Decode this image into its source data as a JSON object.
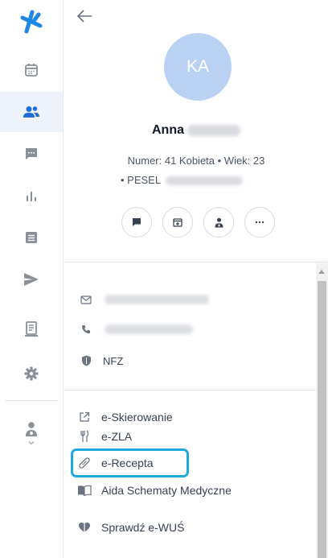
{
  "sidebar": {
    "items": [
      {
        "icon": "logo-icon"
      },
      {
        "icon": "calendar-icon"
      },
      {
        "icon": "patients-icon",
        "active": true
      },
      {
        "icon": "chat-icon"
      },
      {
        "icon": "stats-icon"
      },
      {
        "icon": "list-icon"
      },
      {
        "icon": "send-icon"
      },
      {
        "icon": "document-icon"
      },
      {
        "icon": "settings-icon"
      },
      {
        "icon": "doctor-icon"
      }
    ],
    "colors": {
      "logo": "#1e88e5",
      "active_bg": "#eef3fb",
      "active_icon": "#1e6fd9",
      "icon": "#8a9098"
    }
  },
  "patient": {
    "initials": "KA",
    "first_name": "Anna",
    "meta_line1": "Numer: 41   Kobieta • Wiek: 23",
    "meta_line2": "• PESEL"
  },
  "contact": {
    "insurer": "NFZ"
  },
  "links": {
    "e_skierowanie": "e-Skierowanie",
    "e_zla": "e-ZLA",
    "e_recepta": "e-Recepta",
    "aida": "Aida Schematy Medyczne",
    "ewus": "Sprawdź e-WUŚ"
  },
  "colors": {
    "highlight": "#1fa9e1",
    "avatar": "#b9d2f4"
  }
}
